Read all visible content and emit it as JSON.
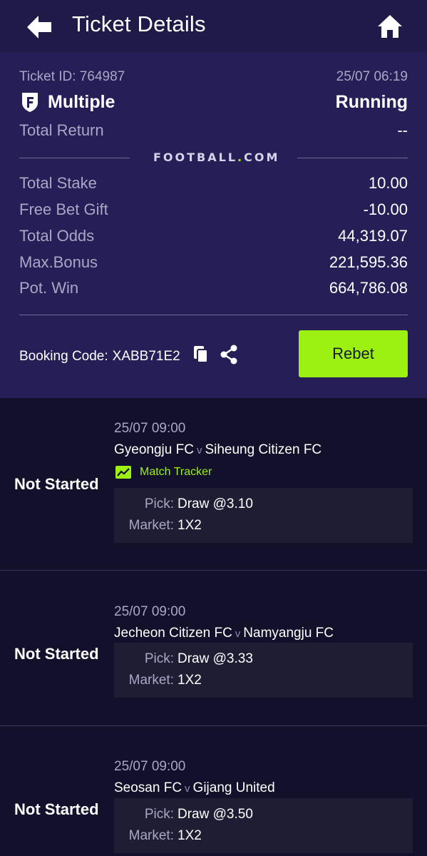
{
  "header": {
    "title": "Ticket Details"
  },
  "ticket": {
    "id_label": "Ticket ID: 764987",
    "datetime": "25/07 06:19",
    "bet_type": "Multiple",
    "status": "Running",
    "total_return_label": "Total Return",
    "total_return_value": "--",
    "brand_prefix": "FOOTBALL",
    "brand_dot": ".",
    "brand_suffix": "COM",
    "stats": [
      {
        "label": "Total Stake",
        "value": "10.00"
      },
      {
        "label": "Free Bet Gift",
        "value": "-10.00"
      },
      {
        "label": "Total Odds",
        "value": "44,319.07"
      },
      {
        "label": "Max.Bonus",
        "value": "221,595.36"
      },
      {
        "label": "Pot. Win",
        "value": "664,786.08"
      }
    ],
    "booking_label": "Booking Code:",
    "booking_code": "XABB71E2",
    "rebet_label": "Rebet"
  },
  "selections": [
    {
      "status": "Not Started",
      "time": "25/07 09:00",
      "home": "Gyeongju FC",
      "vs": "v",
      "away": "Siheung Citizen FC",
      "tracker": "Match Tracker",
      "pick_label": "Pick:",
      "pick_value": "Draw @3.10",
      "market_label": "Market:",
      "market_value": "1X2"
    },
    {
      "status": "Not Started",
      "time": "25/07 09:00",
      "home": "Jecheon Citizen FC",
      "vs": "v",
      "away": "Namyangju FC",
      "pick_label": "Pick:",
      "pick_value": "Draw @3.33",
      "market_label": "Market:",
      "market_value": "1X2"
    },
    {
      "status": "Not Started",
      "time": "25/07 09:00",
      "home": "Seosan FC",
      "vs": "v",
      "away": "Gijang United",
      "pick_label": "Pick:",
      "pick_value": "Draw @3.50",
      "market_label": "Market:",
      "market_value": "1X2"
    }
  ],
  "icons": {
    "back": "arrow-left-icon",
    "home": "home-icon",
    "bet_type": "multiple-bet-icon",
    "copy": "copy-icon",
    "share": "share-icon",
    "tracker": "chart-line-icon"
  },
  "colors": {
    "header_bg": "#1f1a48",
    "card_bg": "#261f57",
    "page_bg": "#12102a",
    "accent": "#9df112"
  }
}
